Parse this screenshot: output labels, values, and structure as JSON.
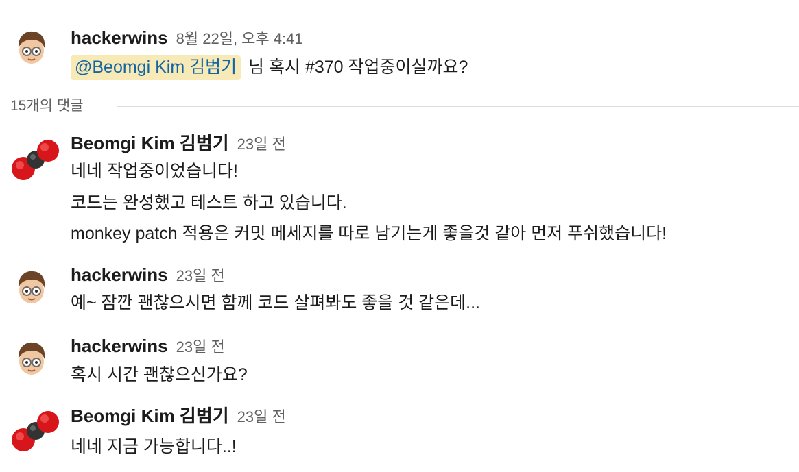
{
  "parent": {
    "author": "hackerwins",
    "timestamp": "8월 22일, 오후 4:41",
    "mention": "@Beomgi Kim 김범기",
    "text": "님 혹시 #370 작업중이실까요?"
  },
  "replies_label": "15개의 댓글",
  "replies": [
    {
      "author": "Beomgi Kim 김범기",
      "timestamp": "23일 전",
      "avatar": "molecule-avatar",
      "lines": [
        "네네 작업중이었습니다!",
        "코드는 완성했고 테스트 하고 있습니다.",
        "monkey patch 적용은 커밋 메세지를 따로 남기는게 좋을것 같아 먼저 푸쉬했습니다!"
      ]
    },
    {
      "author": "hackerwins",
      "timestamp": "23일 전",
      "avatar": "memoji-avatar",
      "lines": [
        "예~ 잠깐 괜찮으시면 함께 코드 살펴봐도 좋을 것 같은데..."
      ]
    },
    {
      "author": "hackerwins",
      "timestamp": "23일 전",
      "avatar": "memoji-avatar",
      "lines": [
        "혹시 시간 괜찮으신가요?"
      ]
    },
    {
      "author": "Beomgi Kim 김범기",
      "timestamp": "23일 전",
      "avatar": "molecule-avatar",
      "lines": [
        "네네 지금 가능합니다..!"
      ]
    }
  ],
  "colors": {
    "mention_bg": "#f8eab7",
    "mention_text": "#1264a3",
    "timestamp": "#616061",
    "text": "#1d1c1d"
  }
}
